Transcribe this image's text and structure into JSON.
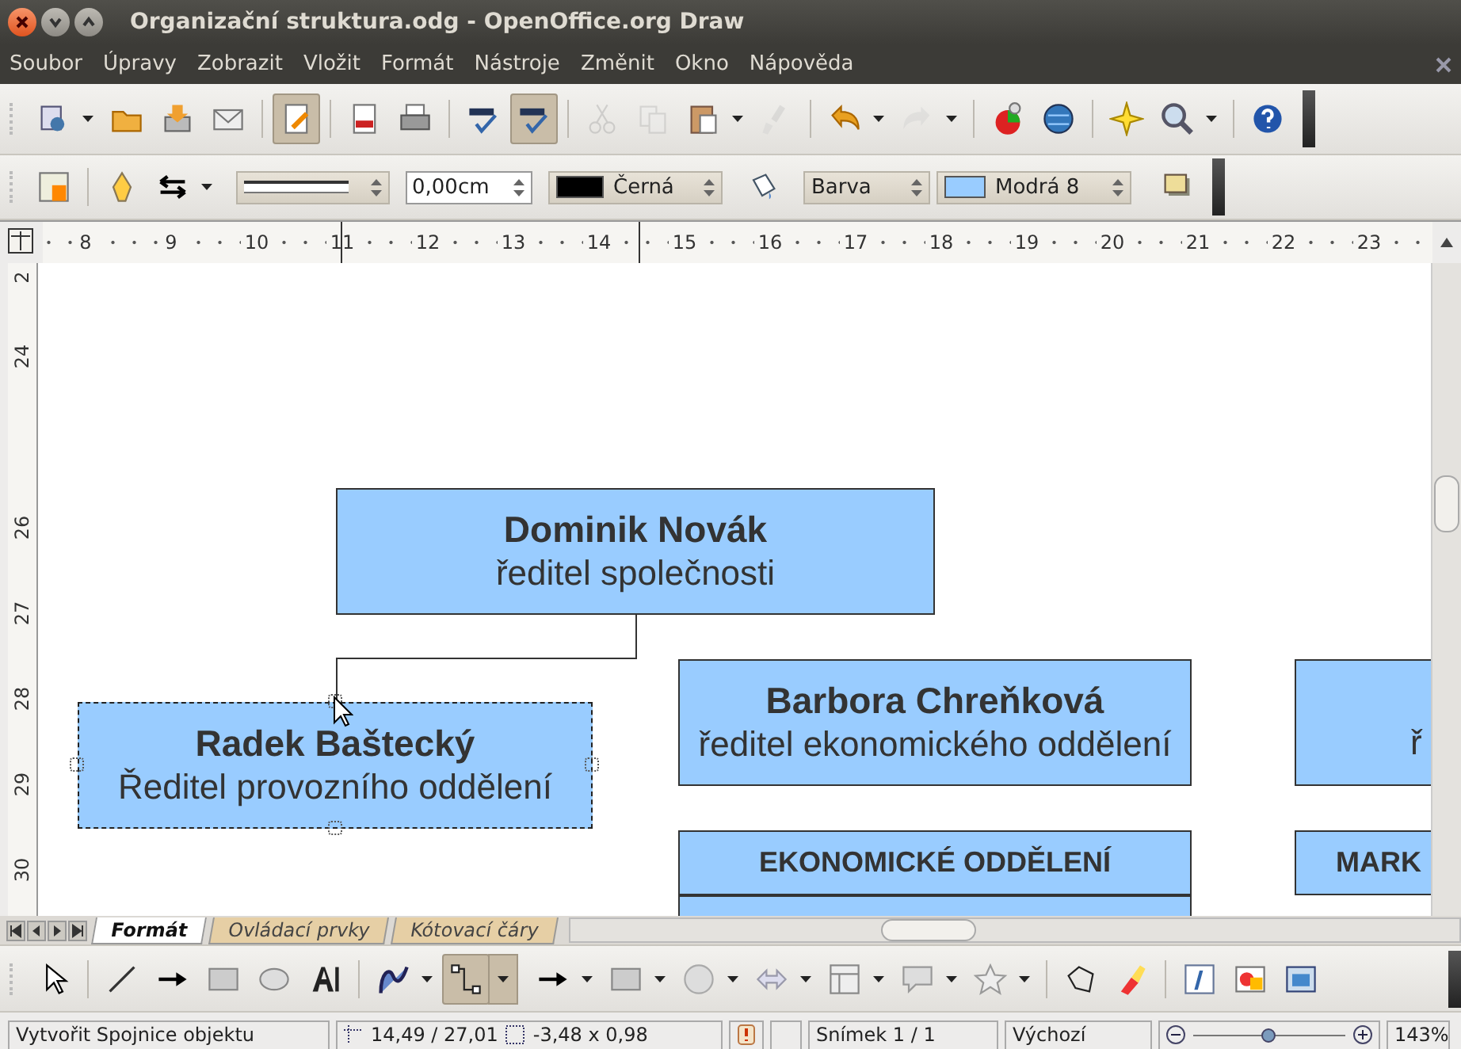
{
  "window": {
    "title": "Organizační struktura.odg - OpenOffice.org Draw"
  },
  "menu": [
    "Soubor",
    "Úpravy",
    "Zobrazit",
    "Vložit",
    "Formát",
    "Nástroje",
    "Změnit",
    "Okno",
    "Nápověda"
  ],
  "standard_toolbar": [
    {
      "selected": false,
      "disabled": false
    },
    {
      "selected": false,
      "disabled": false
    },
    {
      "selected": false,
      "disabled": false
    },
    {
      "selected": false,
      "disabled": false
    },
    {
      "selected": true,
      "disabled": false
    },
    {
      "selected": false,
      "disabled": false
    },
    {
      "selected": false,
      "disabled": false
    },
    {
      "selected": false,
      "disabled": false
    },
    {
      "selected": true,
      "disabled": false
    },
    {
      "selected": false,
      "disabled": true
    },
    {
      "selected": false,
      "disabled": true
    },
    {
      "selected": false,
      "disabled": false
    },
    {
      "selected": false,
      "disabled": true
    },
    {
      "selected": false,
      "disabled": false
    },
    {
      "selected": false,
      "disabled": true
    },
    {
      "selected": false,
      "disabled": false
    },
    {
      "selected": false,
      "disabled": false
    },
    {
      "selected": false,
      "disabled": false
    },
    {
      "selected": false,
      "disabled": false
    },
    {
      "selected": false,
      "disabled": false
    }
  ],
  "line_toolbar": {
    "line_width": "0,00cm",
    "line_color": {
      "label": "Černá",
      "color": "#000000"
    },
    "area_style": "Barva",
    "area_color": {
      "label": "Modrá 8",
      "color": "#99ccff"
    }
  },
  "horizontal_ruler": [
    "8",
    "9",
    "10",
    "11",
    "12",
    "13",
    "14",
    "15",
    "16",
    "17",
    "18",
    "19",
    "20",
    "21",
    "22",
    "23"
  ],
  "vertical_ruler": [
    "2",
    "24",
    "26",
    "27",
    "28",
    "29",
    "30"
  ],
  "shapes": [
    {
      "kind": "node",
      "name": "Dominik Novák",
      "role": "ředitel společnosti",
      "selected": false
    },
    {
      "kind": "node",
      "name": "Radek Baštecký",
      "role": "Ředitel provozního oddělení",
      "selected": true
    },
    {
      "kind": "node",
      "name": "Barbora Chreňková",
      "role": "ředitel ekonomického oddělení",
      "selected": false
    },
    {
      "kind": "node",
      "role": "ř",
      "selected": false
    },
    {
      "kind": "header",
      "name": "EKONOMICKÉ ODDĚLENÍ",
      "selected": false
    },
    {
      "kind": "body",
      "selected": false
    },
    {
      "kind": "header",
      "name": "MARK",
      "selected": false
    }
  ],
  "sheet_tabs": [
    {
      "label": "Formát",
      "selected": true
    },
    {
      "label": "Ovládací prvky",
      "selected": false
    },
    {
      "label": "Kótovací čáry",
      "selected": false
    }
  ],
  "drawing_toolbar": [
    {
      "selected": false
    },
    {
      "selected": false
    },
    {
      "selected": false
    },
    {
      "selected": false
    },
    {
      "selected": false
    },
    {
      "selected": false
    },
    {
      "selected": false
    },
    {
      "selected": true
    },
    {
      "selected": false
    },
    {
      "selected": false
    },
    {
      "selected": false
    },
    {
      "selected": false
    },
    {
      "selected": false
    },
    {
      "selected": false
    },
    {
      "selected": false
    },
    {
      "selected": false
    },
    {
      "selected": false
    },
    {
      "selected": false
    },
    {
      "selected": false
    },
    {
      "selected": false
    }
  ],
  "status_bar": {
    "action": "Vytvořit Spojnice objektu",
    "position": "14,49 / 27,01",
    "size": "-3,48 x 0,98",
    "slide": "Snímek 1 / 1",
    "layout": "Výchozí",
    "zoom_slider": {
      "level": 0.5
    },
    "zoom": "143%"
  }
}
